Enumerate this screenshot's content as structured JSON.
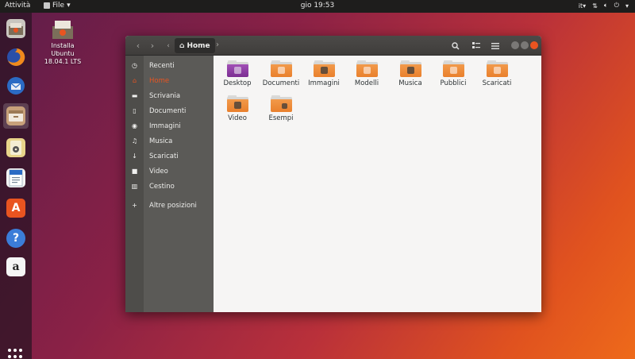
{
  "topbar": {
    "activities": "Attività",
    "app_menu": "File",
    "clock": "gio 19:53",
    "language": "it",
    "tray_icons": [
      "keyboard-layout-icon",
      "network-icon",
      "volume-icon",
      "power-icon"
    ]
  },
  "dock": {
    "items": [
      "installer-icon",
      "firefox-icon",
      "thunderbird-icon",
      "files-icon",
      "rhythmbox-icon",
      "writer-icon",
      "software-icon",
      "help-icon",
      "amazon-icon"
    ],
    "active": "files-icon",
    "app_grid": "app-grid-icon"
  },
  "desktop": {
    "icon_label": "Installa\nUbuntu\n18.04.1 LTS"
  },
  "window": {
    "path_label": "Home",
    "sidebar": [
      {
        "label": "Recenti",
        "icon": "clock-icon"
      },
      {
        "label": "Home",
        "icon": "home-icon",
        "selected": true
      },
      {
        "label": "Scrivania",
        "icon": "folder-icon"
      },
      {
        "label": "Documenti",
        "icon": "document-icon"
      },
      {
        "label": "Immagini",
        "icon": "camera-icon"
      },
      {
        "label": "Musica",
        "icon": "music-icon"
      },
      {
        "label": "Scaricati",
        "icon": "download-icon"
      },
      {
        "label": "Video",
        "icon": "video-icon"
      },
      {
        "label": "Cestino",
        "icon": "trash-icon"
      },
      {
        "label": "Altre posizioni",
        "icon": "plus-icon"
      }
    ],
    "files": [
      {
        "label": "Desktop"
      },
      {
        "label": "Documenti"
      },
      {
        "label": "Immagini"
      },
      {
        "label": "Modelli"
      },
      {
        "label": "Musica"
      },
      {
        "label": "Pubblici"
      },
      {
        "label": "Scaricati"
      },
      {
        "label": "Video"
      },
      {
        "label": "Esempi"
      }
    ]
  }
}
